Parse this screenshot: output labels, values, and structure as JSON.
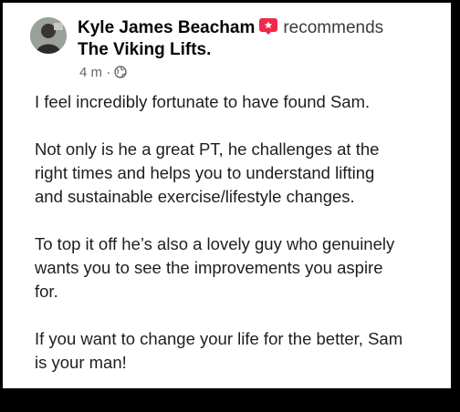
{
  "post": {
    "author": "Kyle James Beacham",
    "action": "recommends",
    "page_name": "The Viking Lifts.",
    "timestamp": "4 m",
    "separator": "·",
    "privacy_icon": "globe-icon",
    "recommend_icon": "recommend-flag-icon",
    "recommend_color": "#f02849",
    "paragraphs": [
      "I feel incredibly fortunate to have found Sam.",
      "Not only is he a great PT, he challenges at the\nright times and helps you to understand lifting\nand sustainable exercise/lifestyle changes.",
      "To top it off he’s also a lovely guy who genuinely\nwants you to see the improvements you aspire\nfor.",
      "If you want to change your life for the better, Sam\nis your man!"
    ]
  }
}
